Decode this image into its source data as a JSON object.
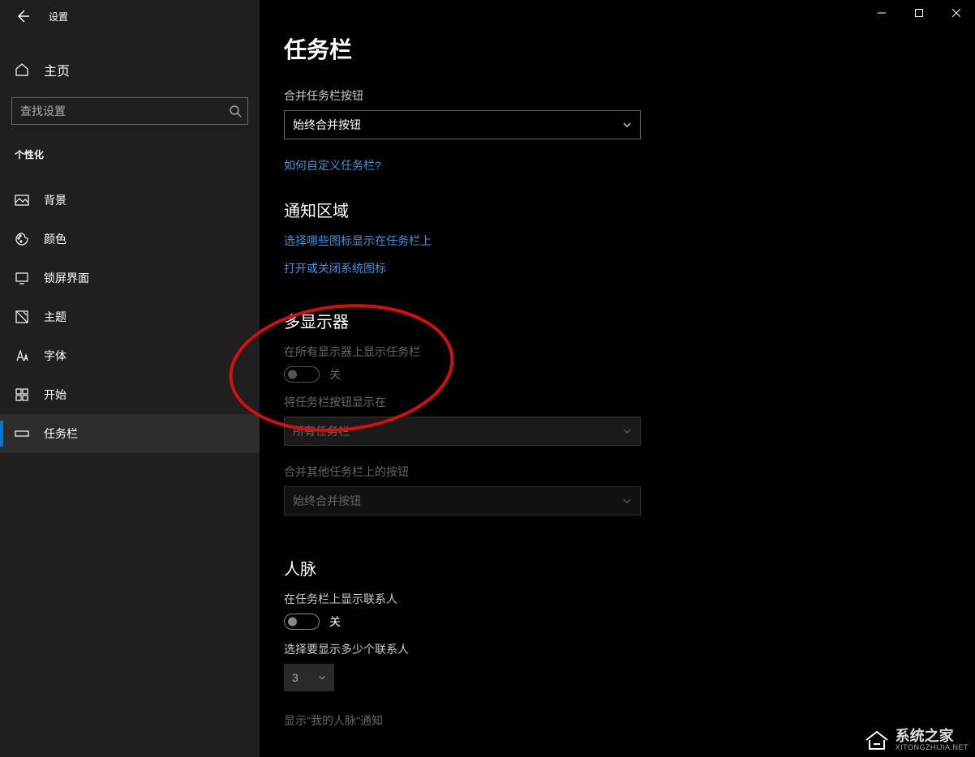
{
  "window": {
    "app_title": "设置"
  },
  "sidebar": {
    "home_label": "主页",
    "search_placeholder": "查找设置",
    "section_label": "个性化",
    "items": [
      {
        "label": "背景"
      },
      {
        "label": "颜色"
      },
      {
        "label": "锁屏界面"
      },
      {
        "label": "主题"
      },
      {
        "label": "字体"
      },
      {
        "label": "开始"
      },
      {
        "label": "任务栏"
      }
    ]
  },
  "main": {
    "page_title": "任务栏",
    "combine_buttons": {
      "label": "合并任务栏按钮",
      "value": "始终合并按钮"
    },
    "customize_link": "如何自定义任务栏?",
    "notification_area": {
      "title": "通知区域",
      "link_select_icons": "选择哪些图标显示在任务栏上",
      "link_system_icons": "打开或关闭系统图标"
    },
    "multi_display": {
      "title": "多显示器",
      "show_on_all_label": "在所有显示器上显示任务栏",
      "show_on_all_state": "关",
      "show_buttons_on_label": "将任务栏按钮显示在",
      "show_buttons_on_value": "所有任务栏",
      "combine_other_label": "合并其他任务栏上的按钮",
      "combine_other_value": "始终合并按钮"
    },
    "people": {
      "title": "人脉",
      "show_contacts_label": "在任务栏上显示联系人",
      "show_contacts_state": "关",
      "choose_count_label": "选择要显示多少个联系人",
      "choose_count_value": "3",
      "my_people_notify_label": "显示\"我的人脉\"通知"
    }
  },
  "watermark": {
    "big": "系统之家",
    "small": "XITONGZHIJIA.NET"
  }
}
